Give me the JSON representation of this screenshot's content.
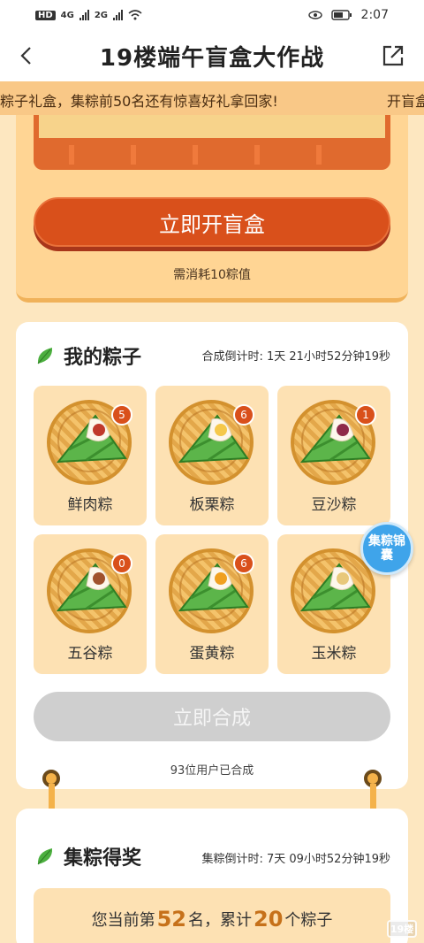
{
  "status_bar": {
    "left_label": "HD",
    "net1": "4G",
    "net2": "2G",
    "time": "2:07"
  },
  "nav": {
    "title": "19楼端午盲盒大作战"
  },
  "marquee": {
    "text_a": "粽子礼盒，集粽前50名还有惊喜好礼拿回家!",
    "text_b": "开盲盒"
  },
  "blind_box": {
    "open_label": "立即开盲盒",
    "cost_text": "需消耗10粽值"
  },
  "my_zongzi": {
    "title": "我的粽子",
    "countdown": "合成倒计时: 1天 21小时52分钟19秒",
    "items": [
      {
        "name": "鲜肉粽",
        "count": "5",
        "filling": "#c0392b"
      },
      {
        "name": "板栗粽",
        "count": "6",
        "filling": "#f5c84a"
      },
      {
        "name": "豆沙粽",
        "count": "1",
        "filling": "#8e2a4a"
      },
      {
        "name": "五谷粽",
        "count": "0",
        "filling": "#a0522d"
      },
      {
        "name": "蛋黄粽",
        "count": "6",
        "filling": "#f0a020"
      },
      {
        "name": "玉米粽",
        "count": "",
        "filling": "#e8c87a"
      }
    ],
    "merge_label": "立即合成",
    "merge_count_text": "93位用户已合成",
    "float_label": "集粽锦囊"
  },
  "prize": {
    "title": "集粽得奖",
    "countdown": "集粽倒计时: 7天 09小时52分钟19秒",
    "rank_prefix": "您当前第",
    "rank": "52",
    "rank_mid": "名，累计",
    "total": "20",
    "rank_suffix": "个粽子"
  },
  "watermark": "19楼",
  "colors": {
    "accent": "#d9501b",
    "page_bg": "#fde7c0",
    "leaf_green": "#4caf3f"
  }
}
